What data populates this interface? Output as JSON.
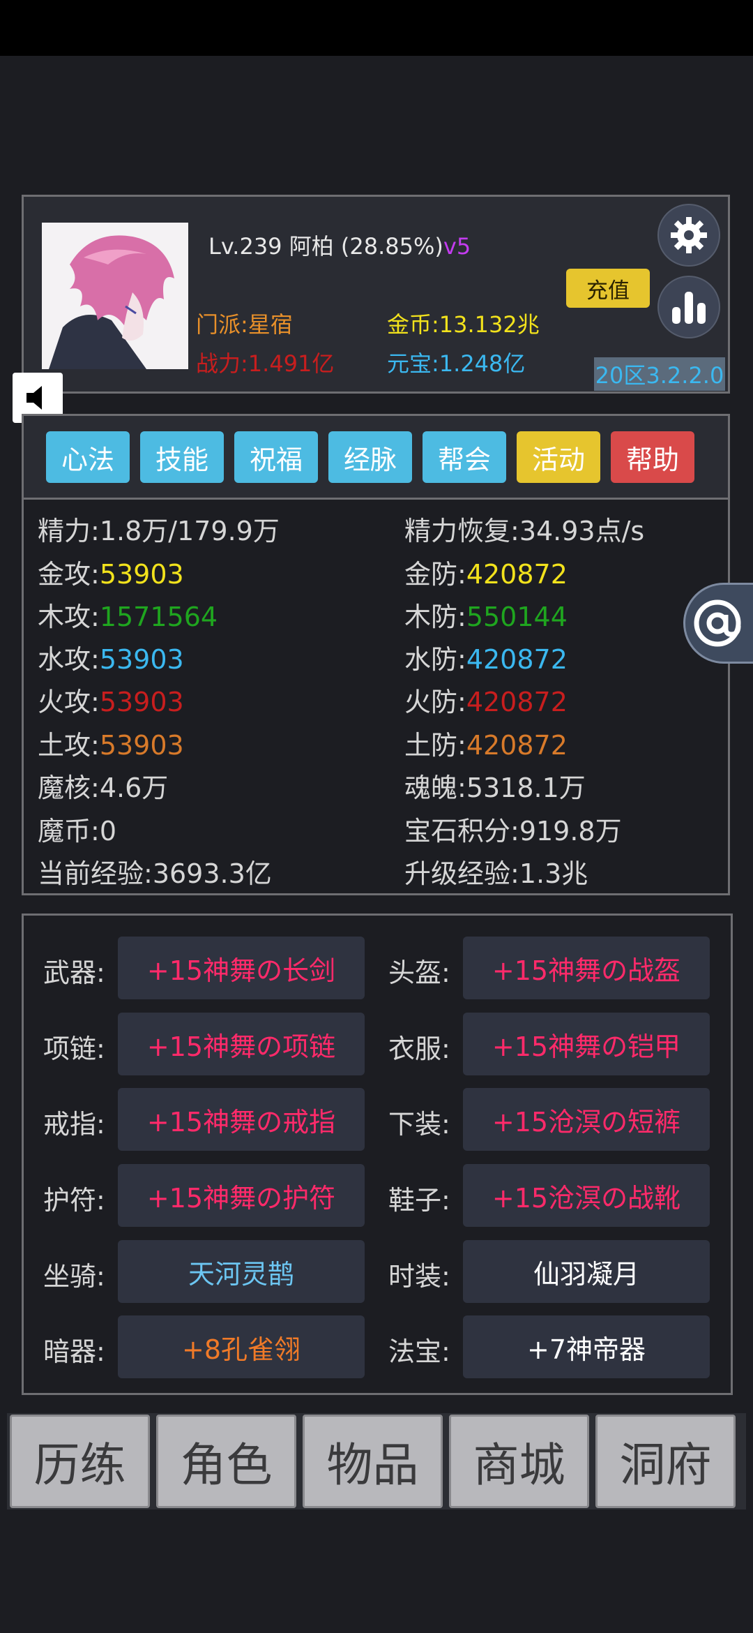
{
  "player": {
    "level_line": "Lv.239 阿柏 (28.85%)",
    "vip": "v5",
    "sect": "门派:星宿",
    "power": "战力:1.491亿",
    "gold": "金币:13.132兆",
    "ingot": "元宝:1.248亿",
    "recharge_label": "充值",
    "server": "20区3.2.2.0"
  },
  "tabs": [
    "心法",
    "技能",
    "祝福",
    "经脉",
    "帮会",
    "活动",
    "帮助"
  ],
  "stats": {
    "energy_label": "精力:",
    "energy_value": "1.8万/179.9万",
    "regen_label": "精力恢复:",
    "regen_value": "34.93点/s",
    "metal_atk_label": "金攻:",
    "metal_atk": "53903",
    "metal_def_label": "金防:",
    "metal_def": "420872",
    "wood_atk_label": "木攻:",
    "wood_atk": "1571564",
    "wood_def_label": "木防:",
    "wood_def": "550144",
    "water_atk_label": "水攻:",
    "water_atk": "53903",
    "water_def_label": "水防:",
    "water_def": "420872",
    "fire_atk_label": "火攻:",
    "fire_atk": "53903",
    "fire_def_label": "火防:",
    "fire_def": "420872",
    "earth_atk_label": "土攻:",
    "earth_atk": "53903",
    "earth_def_label": "土防:",
    "earth_def": "420872",
    "magic_core_label": "魔核:",
    "magic_core": "4.6万",
    "soul_label": "魂魄:",
    "soul": "5318.1万",
    "magic_coin_label": "魔币:",
    "magic_coin": "0",
    "gem_points_label": "宝石积分:",
    "gem_points": "919.8万",
    "exp_label": "当前经验:",
    "exp": "3693.3亿",
    "next_exp_label": "升级经验:",
    "next_exp": "1.3兆"
  },
  "equipment": [
    {
      "slot": "武器:",
      "item": "+15神舞の长剑"
    },
    {
      "slot": "头盔:",
      "item": "+15神舞の战盔"
    },
    {
      "slot": "项链:",
      "item": "+15神舞の项链"
    },
    {
      "slot": "衣服:",
      "item": "+15神舞の铠甲"
    },
    {
      "slot": "戒指:",
      "item": "+15神舞の戒指"
    },
    {
      "slot": "下装:",
      "item": "+15沧溟の短裤"
    },
    {
      "slot": "护符:",
      "item": "+15神舞の护符"
    },
    {
      "slot": "鞋子:",
      "item": "+15沧溟の战靴"
    },
    {
      "slot": "坐骑:",
      "item": "天河灵鹊"
    },
    {
      "slot": "时装:",
      "item": "仙羽凝月"
    },
    {
      "slot": "暗器:",
      "item": "+8孔雀翎"
    },
    {
      "slot": "法宝:",
      "item": "+7神帝器"
    }
  ],
  "nav": [
    "历练",
    "角色",
    "物品",
    "商城",
    "洞府"
  ],
  "colors": {
    "metal": "#f2e21c",
    "wood": "#1fa51f",
    "water": "#3bb8f0",
    "fire": "#c81e1e",
    "earth": "#d87a2a",
    "tab_blue": "#4dbbe2",
    "tab_yellow": "#e6c52e",
    "tab_red": "#d94a4a",
    "equip_red": "#ff2a6a"
  },
  "icons": {
    "settings": "gear-icon",
    "ranking": "bar-chart-icon",
    "sound": "speaker-icon",
    "contact": "at-icon"
  }
}
